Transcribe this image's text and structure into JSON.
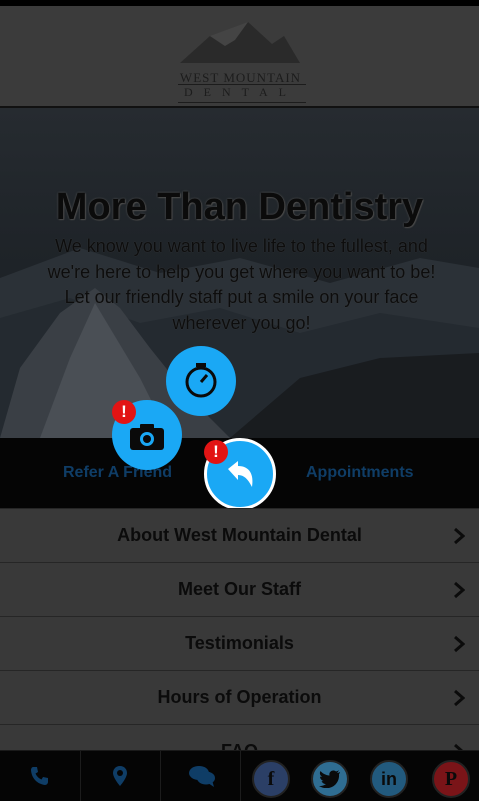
{
  "header": {
    "logo_line1": "WEST MOUNTAIN",
    "logo_line2": "DENTAL"
  },
  "hero": {
    "title": "More Than Dentistry",
    "text": "We know you want to live life to the fullest, and we're here to help you get where you want to be! Let our friendly staff put a smile on your face wherever you go!"
  },
  "tabs": {
    "refer": "Refer A Friend",
    "appointments": "Appointments"
  },
  "fabs": {
    "alert_glyph": "!"
  },
  "menu": {
    "items": [
      {
        "label": "About West Mountain Dental"
      },
      {
        "label": "Meet Our Staff"
      },
      {
        "label": "Testimonials"
      },
      {
        "label": "Hours of Operation"
      },
      {
        "label": "FAQ"
      }
    ]
  },
  "social": {
    "facebook": "f",
    "linkedin": "in",
    "pinterest": "P"
  },
  "colors": {
    "accent": "#1aa8f5",
    "badge": "#e21414"
  }
}
